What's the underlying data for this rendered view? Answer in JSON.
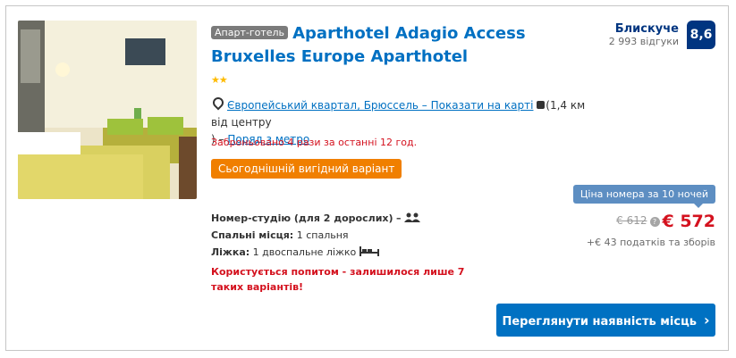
{
  "hotel": {
    "type_badge": "Апарт-готель",
    "name": "Aparthotel Adagio Access Bruxelles Europe Aparthotel",
    "stars": "★★",
    "location_link": "Європейський квартал, Брюссель – Показати на карті",
    "distance": "(1,4 км від центру",
    "distance_close": ")",
    "dash": "–",
    "metro": "Поряд з метро",
    "booked_text": "Заброньовано 4 рази за останні 12 год.",
    "deal_badge": "Сьогоднішній вигідний варіант"
  },
  "rating": {
    "word": "Блискуче",
    "reviews": "2 993 відгуки",
    "score": "8,6"
  },
  "room": {
    "name": "Номер-студію (для 2 дорослих)",
    "sleeps_label": "Спальні місця:",
    "sleeps_value": "1 спальня",
    "beds_label": "Ліжка:",
    "beds_value": "1 двоспальне ліжко",
    "scarcity": "Користується попитом - залишилося лише 7 таких варіантів!"
  },
  "price": {
    "nights_label": "Ціна номера за 10 ночей",
    "old": "€ 612",
    "new": "€ 572",
    "taxes": "+€ 43 податків та зборів"
  },
  "cta": {
    "label": "Переглянути наявність місць",
    "chevron": "›"
  },
  "colors": {
    "link": "#0070c2",
    "score_bg": "#003580",
    "deal": "#f07f00",
    "red": "#d4111e",
    "cta": "#0071c2"
  },
  "icons": [
    "map-pin-icon",
    "external-window-icon",
    "people-icon",
    "double-bed-icon",
    "info-icon",
    "chevron-right-icon"
  ]
}
